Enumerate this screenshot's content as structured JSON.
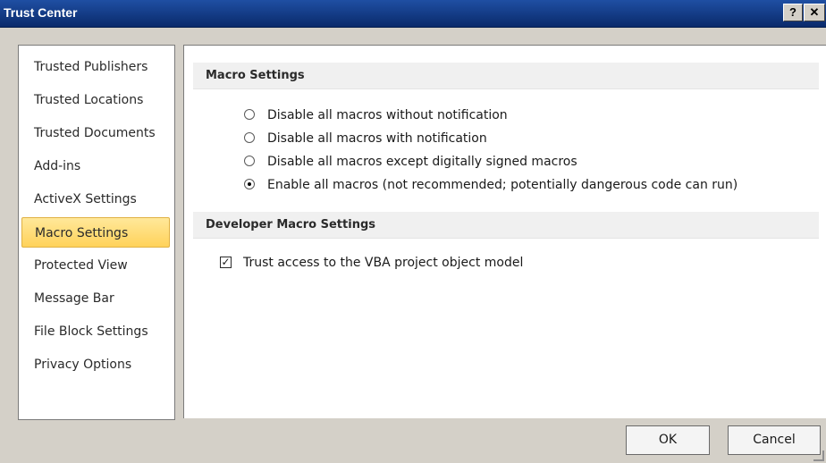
{
  "window": {
    "title": "Trust Center",
    "help_label": "?",
    "close_label": "✕"
  },
  "nav": {
    "items": [
      {
        "label": "Trusted Publishers"
      },
      {
        "label": "Trusted Locations"
      },
      {
        "label": "Trusted Documents"
      },
      {
        "label": "Add-ins"
      },
      {
        "label": "ActiveX Settings"
      },
      {
        "label": "Macro Settings",
        "selected": true
      },
      {
        "label": "Protected View"
      },
      {
        "label": "Message Bar"
      },
      {
        "label": "File Block Settings"
      },
      {
        "label": "Privacy Options"
      }
    ]
  },
  "macro": {
    "heading": "Macro Settings",
    "options": [
      {
        "label": "Disable all macros without notification",
        "checked": false
      },
      {
        "label": "Disable all macros with notification",
        "checked": false
      },
      {
        "label": "Disable all macros except digitally signed macros",
        "checked": false
      },
      {
        "label": "Enable all macros (not recommended; potentially dangerous code can run)",
        "checked": true
      }
    ]
  },
  "developer": {
    "heading": "Developer Macro Settings",
    "vba_label": "Trust access to the VBA project object model",
    "vba_checked": true
  },
  "buttons": {
    "ok": "OK",
    "cancel": "Cancel"
  },
  "colors": {
    "titlebar": "#1f4fa3",
    "selected_nav": "#ffd25a"
  }
}
